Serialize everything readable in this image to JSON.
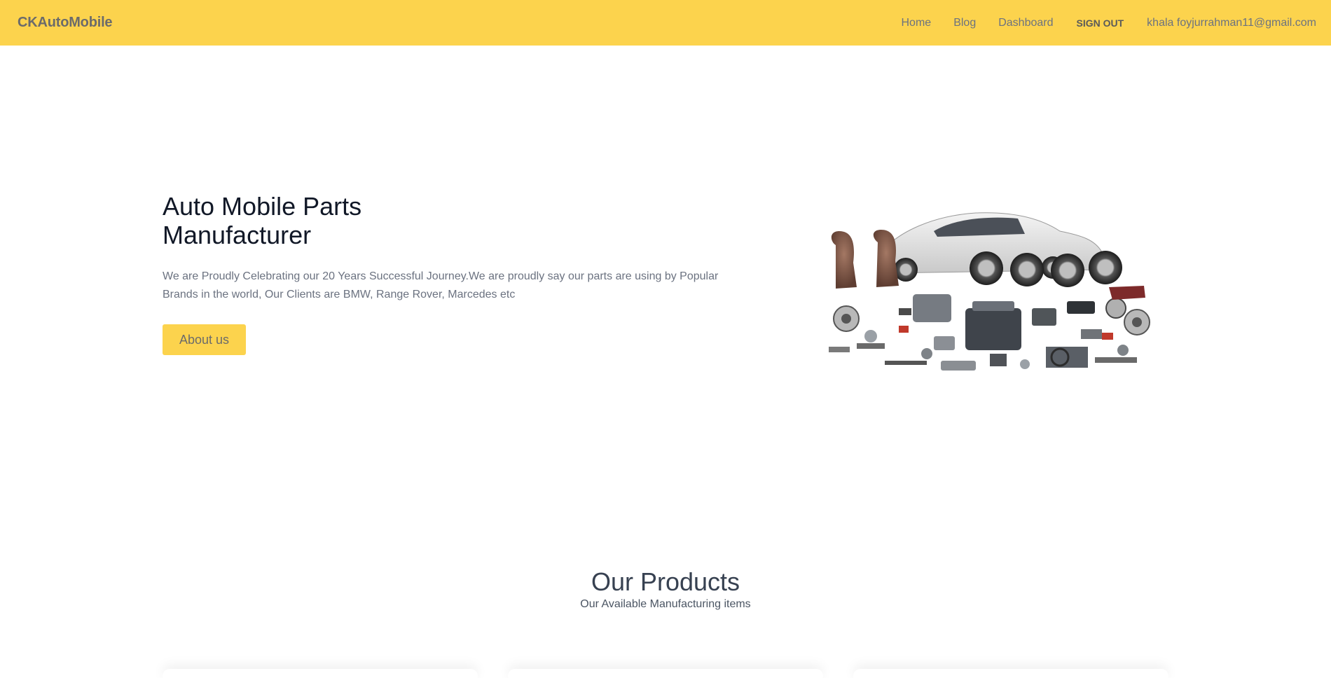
{
  "navbar": {
    "brand": "CKAutoMobile",
    "links": [
      {
        "label": "Home"
      },
      {
        "label": "Blog"
      },
      {
        "label": "Dashboard"
      }
    ],
    "sign_out": "SIGN OUT",
    "user": "khala foyjurrahman11@gmail.com",
    "bg_color": "#fcd34d"
  },
  "hero": {
    "title": "Auto Mobile Parts Manufacturer",
    "description": "We are Proudly Celebrating our 20 Years Successful Journey.We are proudly say our parts are using by Popular Brands in the world, Our Clients are BMW, Range Rover, Marcedes etc",
    "button_label": "About us",
    "accent_color": "#fcd34d"
  },
  "products": {
    "title": "Our Products",
    "subtitle": "Our Available Manufacturing items"
  }
}
